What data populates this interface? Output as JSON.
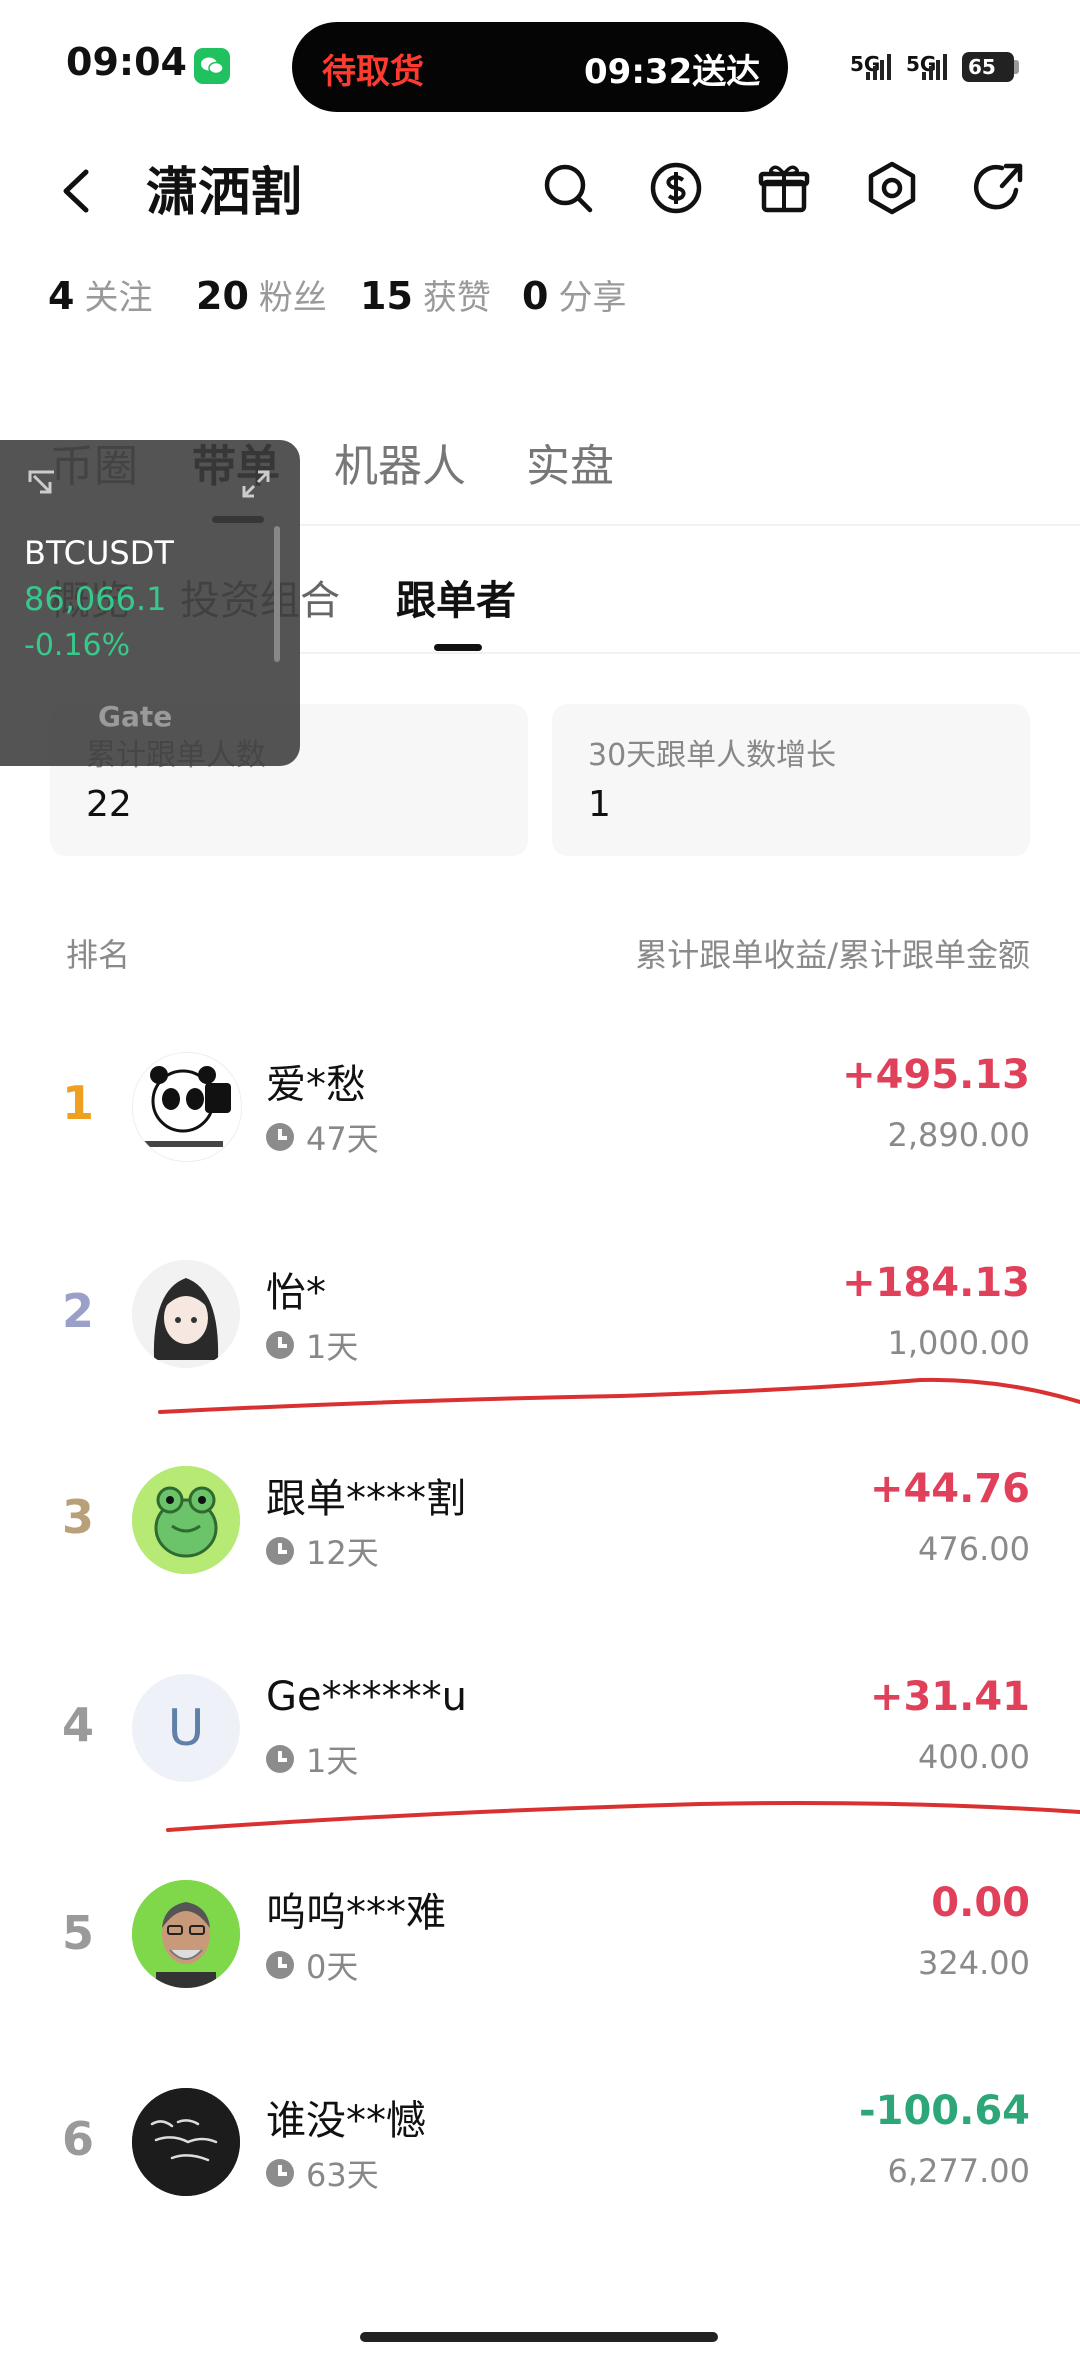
{
  "status": {
    "time": "09:04",
    "pill_left": "待取货",
    "pill_right": "09:32送达",
    "sig1": "5G",
    "sig2": "5G",
    "battery": "65"
  },
  "header": {
    "title": "潇洒割"
  },
  "stats": [
    {
      "num": "4",
      "label": "关注"
    },
    {
      "num": "20",
      "label": "粉丝"
    },
    {
      "num": "15",
      "label": "获赞"
    },
    {
      "num": "0",
      "label": "分享"
    }
  ],
  "tabs": [
    "币圈",
    "带单",
    "机器人",
    "实盘"
  ],
  "subtabs": [
    "概览",
    "投资组合",
    "跟单者"
  ],
  "cards": [
    {
      "label": "累计跟单人数",
      "value": "22"
    },
    {
      "label": "30天跟单人数增长",
      "value": "1"
    }
  ],
  "list_header": {
    "left": "排名",
    "right": "累计跟单收益/累计跟单金额"
  },
  "rows": [
    {
      "rank": "1",
      "name": "爱*愁",
      "days": "47天",
      "profit": "+495.13",
      "amount": "2,890.00"
    },
    {
      "rank": "2",
      "name": "怡*",
      "days": "1天",
      "profit": "+184.13",
      "amount": "1,000.00"
    },
    {
      "rank": "3",
      "name": "跟单****割",
      "days": "12天",
      "profit": "+44.76",
      "amount": "476.00"
    },
    {
      "rank": "4",
      "name": "Ge******u",
      "days": "1天",
      "profit": "+31.41",
      "amount": "400.00",
      "avatar_letter": "U"
    },
    {
      "rank": "5",
      "name": "呜呜***难",
      "days": "0天",
      "profit": "0.00",
      "amount": "324.00"
    },
    {
      "rank": "6",
      "name": "谁没**憾",
      "days": "63天",
      "profit": "-100.64",
      "amount": "6,277.00"
    }
  ],
  "widget": {
    "symbol": "BTCUSDT",
    "price": "86,066.1",
    "change": "-0.16%",
    "brand": "Gate"
  },
  "colors": {
    "gain": "#e0405a",
    "loss": "#2ea778",
    "rank1": "#f0a020",
    "rank2": "#9aa0c8",
    "rank3": "#b8a078",
    "rank_other": "#9a9a9a",
    "annotation": "#d93030"
  }
}
